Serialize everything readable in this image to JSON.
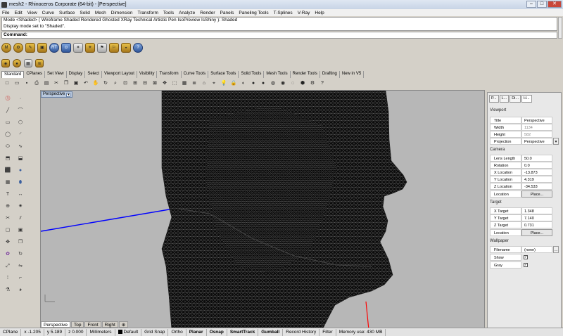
{
  "window": {
    "title": "mesh2 - Rhinoceros Corporate (64-bit) - [Perspective]",
    "btn_min": "–",
    "btn_max": "□",
    "btn_close": "✕"
  },
  "menu": [
    "File",
    "Edit",
    "View",
    "Curve",
    "Surface",
    "Solid",
    "Mesh",
    "Dimension",
    "Transform",
    "Tools",
    "Analyze",
    "Render",
    "Panels",
    "Paneling Tools",
    "T-Splines",
    "V-Ray",
    "Help"
  ],
  "command_history": {
    "line1": "Mode <Shaded> ( Wireframe  Shaded  Rendered  Ghosted  XRay  Technical  Artistic  Pen  IsoPreview  IsShiny ): Shaded",
    "line2": "Display mode set to \"Shaded\"."
  },
  "command": {
    "label": "Command:"
  },
  "tabs": [
    "Standard",
    "CPlanes",
    "Set View",
    "Display",
    "Select",
    "Viewport Layout",
    "Visibility",
    "Transform",
    "Curve Tools",
    "Surface Tools",
    "Solid Tools",
    "Mesh Tools",
    "Render Tools",
    "Drafting",
    "New in V5"
  ],
  "viewport": {
    "title": "Perspective",
    "tabs": [
      "Perspective",
      "Top",
      "Front",
      "Right"
    ],
    "add_tab": "⊕"
  },
  "panel": {
    "tabs": [
      "P...",
      "L...",
      "Di...",
      "H..."
    ],
    "viewport_section": "Viewport",
    "title_label": "Title",
    "title_value": "Perspective",
    "width_label": "Width",
    "width_value": "1134",
    "height_label": "Height",
    "height_value": "582",
    "projection_label": "Projection",
    "projection_value": "Perspective",
    "camera_section": "Camera",
    "lens_label": "Lens Length",
    "lens_value": "50.0",
    "rotation_label": "Rotation",
    "rotation_value": "0.0",
    "xloc_label": "X Location",
    "xloc_value": "-13.873",
    "yloc_label": "Y Location",
    "yloc_value": "4.319",
    "zloc_label": "Z Location",
    "zloc_value": "-34.533",
    "location_label": "Location",
    "place_label": "Place...",
    "target_section": "Target",
    "xt_label": "X Target",
    "xt_value": "1.348",
    "yt_label": "Y Target",
    "yt_value": "7.140",
    "zt_label": "Z Target",
    "zt_value": "0.731",
    "tlocation_label": "Location",
    "tplace_label": "Place...",
    "wallpaper_section": "Wallpaper",
    "filename_label": "Filename",
    "filename_value": "(none)",
    "filename_btn": "...",
    "show_label": "Show",
    "gray_label": "Gray"
  },
  "status": {
    "cplane": "CPlane",
    "x": "x -1.205",
    "y": "y 5.189",
    "z": "z 0.000",
    "units": "Millimeters",
    "layer": "Default",
    "grid_snap": "Grid Snap",
    "ortho": "Ortho",
    "planar": "Planar",
    "osnap": "Osnap",
    "smarttrack": "SmartTrack",
    "gumball": "Gumball",
    "record_history": "Record History",
    "filter": "Filter",
    "memory": "Memory use: 430 MB"
  },
  "colors": {
    "accent": "#3a5f9f",
    "viewport_bg": "#b7b7b7",
    "mesh": "#000000",
    "axis_x": "#0000ff",
    "axis_z": "#ff0000"
  }
}
